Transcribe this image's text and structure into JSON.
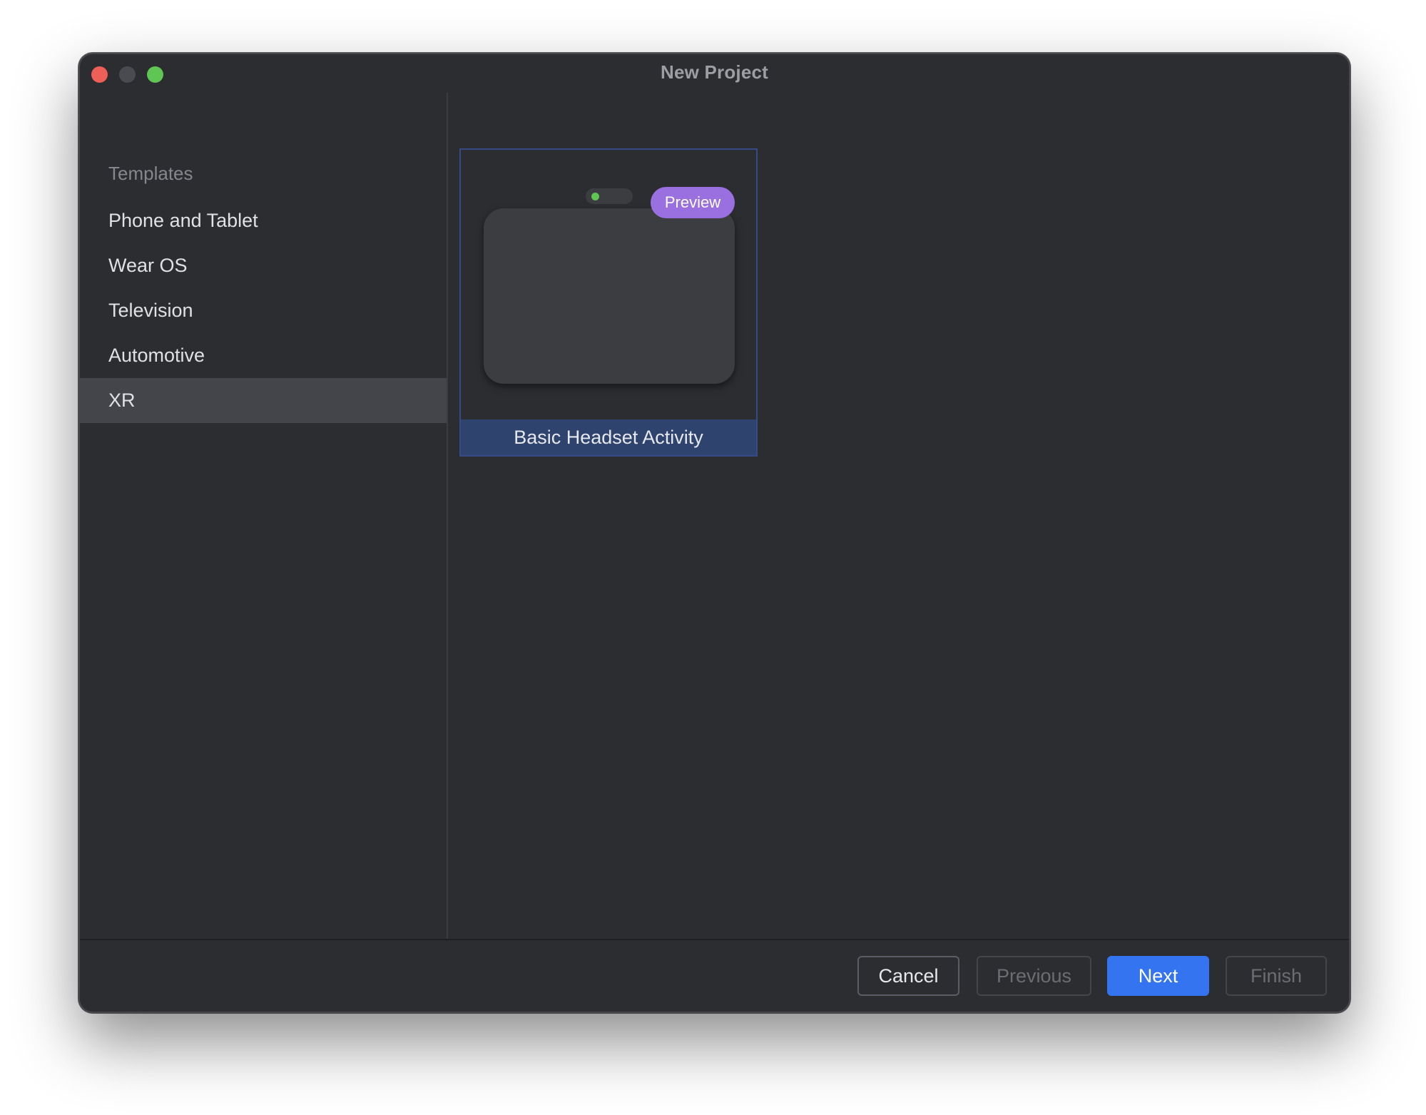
{
  "window": {
    "title": "New Project"
  },
  "sidebar": {
    "heading": "Templates",
    "items": [
      {
        "label": "Phone and Tablet",
        "selected": false
      },
      {
        "label": "Wear OS",
        "selected": false
      },
      {
        "label": "Television",
        "selected": false
      },
      {
        "label": "Automotive",
        "selected": false
      },
      {
        "label": "XR",
        "selected": true
      }
    ]
  },
  "templates": [
    {
      "label": "Basic Headset Activity",
      "badge": "Preview",
      "selected": true,
      "icon": "headset-preview-icon"
    }
  ],
  "footer": {
    "cancel_label": "Cancel",
    "previous_label": "Previous",
    "next_label": "Next",
    "finish_label": "Finish"
  },
  "colors": {
    "window_bg": "#2b2d31",
    "selected_item_bg": "#43454a",
    "card_label_bg": "#2e436e",
    "accent": "#3574f0",
    "preview_badge": "#9a6fe0",
    "close": "#ee5f57",
    "maximize": "#5fc553"
  }
}
